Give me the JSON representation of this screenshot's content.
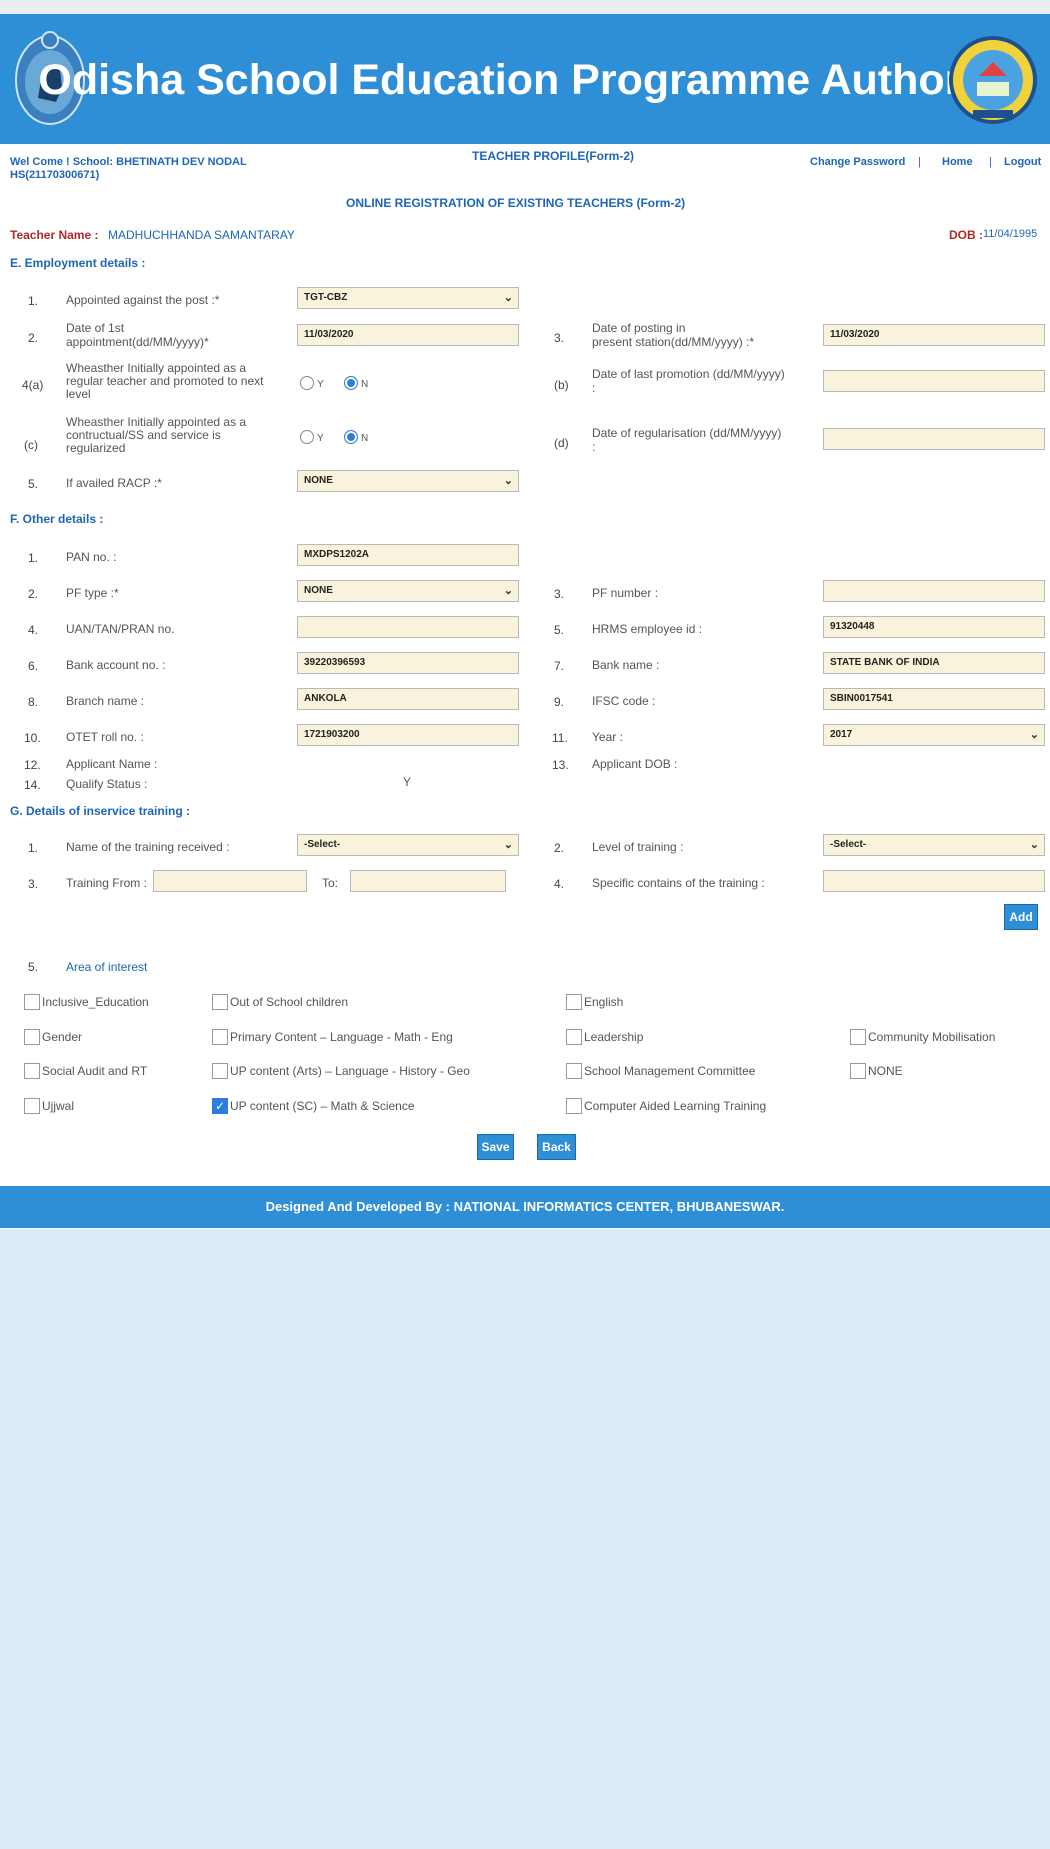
{
  "header": {
    "title": "Odisha School Education Programme Authority",
    "left_emblem": "odisha-govt-emblem",
    "right_emblem": "osepa-logo"
  },
  "topbar": {
    "welcome": "Wel Come  !  School: BHETINATH DEV NODAL",
    "school_code": "HS(21170300671)",
    "page_title": "TEACHER PROFILE(Form-2)",
    "change_password": "Change Password",
    "sep1": "|",
    "home": "Home",
    "sep2": "|",
    "logout": "Logout"
  },
  "form_heading": "ONLINE REGISTRATION OF EXISTING TEACHERS (Form-2)",
  "teacher": {
    "name_label": "Teacher Name :",
    "name": "MADHUCHHANDA SAMANTARAY",
    "dob_label": "DOB :",
    "dob": "11/04/1995"
  },
  "employment": {
    "heading": "E. Employment details :",
    "post_num": "1.",
    "post_label": "Appointed against the post :*",
    "post_value": "TGT-CBZ",
    "first_appt_num": "2.",
    "first_appt_label1": "Date of 1st",
    "first_appt_label2": "appointment(dd/MM/yyyy)*",
    "first_appt_value": "11/03/2020",
    "posting_num": "3.",
    "posting_label1": "Date of posting in",
    "posting_label2": "present station(dd/MM/yyyy) :*",
    "posting_value": "11/03/2020",
    "regular_num": "4(a)",
    "regular_label1": "Wheasther Initially appointed as a",
    "regular_label2": "regular teacher and promoted to next",
    "regular_label3": "level",
    "radio_y": "Y",
    "radio_n": "N",
    "promo_num": "(b)",
    "promo_label": "Date of last promotion (dd/MM/yyyy)",
    "promo_label2": ":",
    "promo_value": "",
    "contract_num": "(c)",
    "contract_label1": "Wheasther Initially appointed as a",
    "contract_label2": "contructual/SS and service is",
    "contract_label3": "regularized",
    "regularisation_num": "(d)",
    "regularisation_label": "Date of regularisation (dd/MM/yyyy)",
    "regularisation_label2": ":",
    "regularisation_value": "",
    "racp_num": "5.",
    "racp_label": "If availed RACP :*",
    "racp_value": "NONE"
  },
  "other": {
    "heading": "F. Other details :",
    "pan_num": "1.",
    "pan_label": "PAN no. :",
    "pan_value": "MXDPS1202A",
    "pftype_num": "2.",
    "pftype_label": "PF type :*",
    "pftype_value": "NONE",
    "pfnum_num": "3.",
    "pfnum_label": "PF number :",
    "pfnum_value": "",
    "uan_num": "4.",
    "uan_label": "UAN/TAN/PRAN no.",
    "uan_value": "",
    "hrms_num": "5.",
    "hrms_label": "HRMS employee id :",
    "hrms_value": "91320448",
    "bankacc_num": "6.",
    "bankacc_label": "Bank account no. :",
    "bankacc_value": "39220396593",
    "bankname_num": "7.",
    "bankname_label": "Bank name :",
    "bankname_value": "STATE BANK OF INDIA",
    "branch_num": "8.",
    "branch_label": "Branch name :",
    "branch_value": "ANKOLA",
    "ifsc_num": "9.",
    "ifsc_label": "IFSC code :",
    "ifsc_value": "SBIN0017541",
    "otet_num": "10.",
    "otet_label": "OTET roll no. :",
    "otet_value": "1721903200",
    "year_num": "11.",
    "year_label": "Year :",
    "year_value": "2017",
    "appname_num": "12.",
    "appname_label": "Applicant Name :",
    "appdob_num": "13.",
    "appdob_label": "Applicant DOB :",
    "qualify_num": "14.",
    "qualify_label": "Qualify Status :",
    "qualify_value": "Y"
  },
  "training": {
    "heading": "G. Details of inservice training :",
    "name_num": "1.",
    "name_label": "Name of the training received :",
    "name_value": "-Select-",
    "level_num": "2.",
    "level_label": "Level of training :",
    "level_value": "-Select-",
    "from_num": "3.",
    "from_label": "Training From :",
    "to_label": "To:",
    "specific_num": "4.",
    "specific_label": "Specific contains of the training :",
    "add_label": "Add"
  },
  "interest": {
    "num": "5.",
    "heading": "Area of interest",
    "items": [
      {
        "label": "Inclusive_Education",
        "checked": false
      },
      {
        "label": "Out of School children",
        "checked": false
      },
      {
        "label": "English",
        "checked": false
      },
      {
        "label": "Gender",
        "checked": false
      },
      {
        "label": "Primary Content – Language - Math - Eng",
        "checked": false
      },
      {
        "label": "Leadership",
        "checked": false
      },
      {
        "label": "Community Mobilisation",
        "checked": false
      },
      {
        "label": "Social Audit and RT",
        "checked": false
      },
      {
        "label": "UP content (Arts) – Language - History - Geo",
        "checked": false
      },
      {
        "label": "School Management Committee",
        "checked": false
      },
      {
        "label": "NONE",
        "checked": false
      },
      {
        "label": "Ujjwal",
        "checked": false
      },
      {
        "label": "UP content (SC) – Math & Science",
        "checked": true
      },
      {
        "label": "Computer Aided Learning Training",
        "checked": false
      }
    ]
  },
  "actions": {
    "save": "Save",
    "back": "Back"
  },
  "footer": {
    "text": "Designed And Developed By  :  NATIONAL INFORMATICS CENTER,  BHUBANESWAR."
  }
}
